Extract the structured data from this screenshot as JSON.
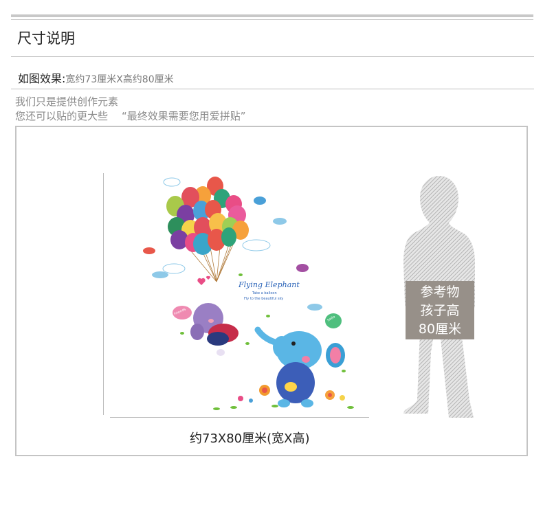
{
  "section": {
    "title": "尺寸说明"
  },
  "effect": {
    "label": "如图效果:",
    "value": "宽约73厘米X高约80厘米"
  },
  "notes": {
    "line1": "我们只是提供创作元素",
    "line2": "您还可以贴的更大些",
    "quote": "“最终效果需要您用爱拼贴”"
  },
  "figure": {
    "caption": "约73X80厘米(宽X高)",
    "reference": {
      "line1": "参考物",
      "line2": "孩子高",
      "line3": "80厘米"
    },
    "art": {
      "title": "Flying Elephant",
      "sub1": "Take a balloon",
      "sub2": "Fly to the beautiful sky",
      "bubble1": "Friends",
      "bubble2": "hello"
    }
  }
}
